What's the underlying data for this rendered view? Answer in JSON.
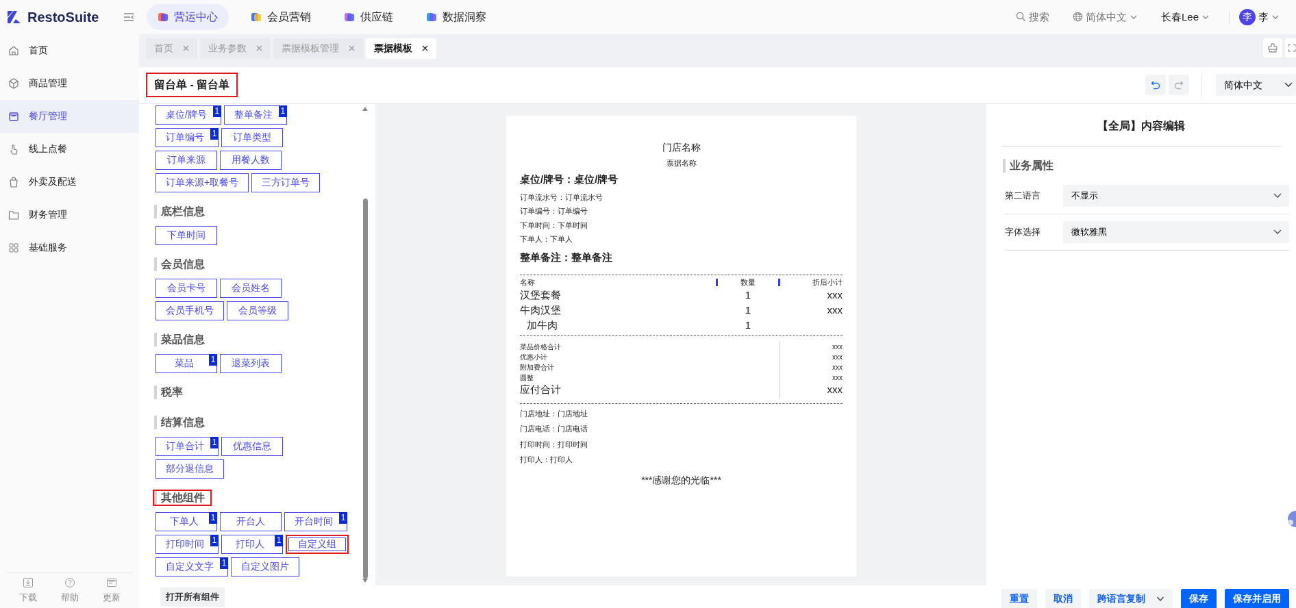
{
  "app": {
    "logo": "RestoSuite"
  },
  "top_nav": [
    {
      "label": "营运中心",
      "selected": true
    },
    {
      "label": "会员营销",
      "selected": false
    },
    {
      "label": "供应链",
      "selected": false
    },
    {
      "label": "数据洞察",
      "selected": false
    }
  ],
  "top_right": {
    "search": "搜索",
    "language": "简体中文",
    "store": "长春Lee",
    "avatar": "李",
    "user": "李"
  },
  "sidebar": {
    "items": [
      {
        "label": "首页",
        "selected": false
      },
      {
        "label": "商品管理",
        "selected": false
      },
      {
        "label": "餐厅管理",
        "selected": true
      },
      {
        "label": "线上点餐",
        "selected": false
      },
      {
        "label": "外卖及配送",
        "selected": false
      },
      {
        "label": "财务管理",
        "selected": false
      },
      {
        "label": "基础服务",
        "selected": false
      }
    ],
    "footer": [
      "下载",
      "帮助",
      "更新"
    ]
  },
  "tabs": [
    {
      "label": "首页",
      "selected": false
    },
    {
      "label": "业务参数",
      "selected": false
    },
    {
      "label": "票据模板管理",
      "selected": false
    },
    {
      "label": "票据模板",
      "selected": true
    }
  ],
  "header": {
    "title": "留台单 - 留台单",
    "highlighted": true,
    "language": "简体中文"
  },
  "components": {
    "sections": [
      {
        "rows": [
          [
            {
              "label": "桌位/牌号",
              "count": "1",
              "highlighted": false
            },
            {
              "label": "整单备注",
              "count": "1",
              "highlighted": false
            }
          ],
          [
            {
              "label": "订单编号",
              "count": "1",
              "highlighted": false
            },
            {
              "label": "订单类型",
              "highlighted": false
            }
          ],
          [
            {
              "label": "订单来源",
              "highlighted": false
            },
            {
              "label": "用餐人数",
              "highlighted": false
            }
          ],
          [
            {
              "label": "订单来源+取餐号",
              "highlighted": false
            },
            {
              "label": "三方订单号",
              "highlighted": false
            }
          ]
        ]
      },
      {
        "title": "底栏信息",
        "highlighted": false,
        "rows": [
          [
            {
              "label": "下单时间",
              "highlighted": false
            }
          ]
        ]
      },
      {
        "title": "会员信息",
        "highlighted": false,
        "rows": [
          [
            {
              "label": "会员卡号",
              "highlighted": false
            },
            {
              "label": "会员姓名",
              "highlighted": false
            }
          ],
          [
            {
              "label": "会员手机号",
              "highlighted": false
            },
            {
              "label": "会员等级",
              "highlighted": false
            }
          ]
        ]
      },
      {
        "title": "菜品信息",
        "highlighted": false,
        "rows": [
          [
            {
              "label": "菜品",
              "count": "1",
              "highlighted": false
            },
            {
              "label": "退菜列表",
              "highlighted": false
            }
          ]
        ]
      },
      {
        "title": "税率",
        "highlighted": false
      },
      {
        "title": "结算信息",
        "highlighted": false,
        "rows": [
          [
            {
              "label": "订单合计",
              "count": "1",
              "highlighted": false
            },
            {
              "label": "优惠信息",
              "highlighted": false
            }
          ],
          [
            {
              "label": "部分退信息",
              "highlighted": false
            }
          ]
        ]
      },
      {
        "title": "其他组件",
        "highlighted": true,
        "rows": [
          [
            {
              "label": "下单人",
              "count": "1",
              "highlighted": false
            },
            {
              "label": "开台人",
              "highlighted": false
            },
            {
              "label": "开台时间",
              "count": "1",
              "highlighted": false
            }
          ],
          [
            {
              "label": "打印时间",
              "count": "1",
              "highlighted": false
            },
            {
              "label": "打印人",
              "count": "1",
              "highlighted": false
            },
            {
              "label": "自定义组",
              "highlighted": true
            }
          ],
          [
            {
              "label": "自定义文字",
              "count": "1",
              "highlighted": false
            },
            {
              "label": "自定义图片",
              "highlighted": false
            }
          ]
        ]
      }
    ],
    "open_all_button": "打开所有组件"
  },
  "receipt": {
    "store_name": "门店名称",
    "receipt_name": "票据名称",
    "header_lines": [
      {
        "text": "桌位/牌号：桌位/牌号",
        "kind": "emphasis"
      },
      {
        "text": "订单流水号：订单流水号",
        "kind": "normal"
      },
      {
        "text": "订单编号：订单编号",
        "kind": "normal"
      },
      {
        "text": "下单时间：下单时间",
        "kind": "normal"
      },
      {
        "text": "下单人：下单人",
        "kind": "normal"
      },
      {
        "text": "整单备注：整单备注",
        "kind": "emphasis"
      }
    ],
    "columns": [
      "名称",
      "数量",
      "折后小计"
    ],
    "items": [
      {
        "name": "汉堡套餐",
        "qty": "1",
        "subtotal": "xxx",
        "kind": "dish"
      },
      {
        "name": "牛肉汉堡",
        "qty": "1",
        "subtotal": "xxx",
        "kind": "dish"
      },
      {
        "name": "加牛肉",
        "qty": "1",
        "kind": "modifier"
      }
    ],
    "totals": [
      {
        "label": "菜品价格合计",
        "value": "xxx",
        "kind": "normal"
      },
      {
        "label": "优惠小计",
        "value": "xxx",
        "kind": "normal"
      },
      {
        "label": "附加费合计",
        "value": "xxx",
        "kind": "normal"
      },
      {
        "label": "圆整",
        "value": "xxx",
        "kind": "normal"
      },
      {
        "label": "应付合计",
        "value": "xxx",
        "kind": "emphasis"
      }
    ],
    "footer_lines": [
      "门店地址：门店地址",
      "门店电话：门店电话",
      "打印时间：打印时间",
      "打印人：打印人"
    ],
    "thanks": "***感谢您的光临***"
  },
  "properties": {
    "title": "【全局】内容编辑",
    "section": "业务属性",
    "fields": [
      {
        "label": "第二语言",
        "value": "不显示"
      },
      {
        "label": "字体选择",
        "value": "微软雅黑"
      }
    ]
  },
  "actions": [
    {
      "label": "重置",
      "kind": "secondary"
    },
    {
      "label": "取消",
      "kind": "secondary"
    },
    {
      "label": "跨语言复制",
      "kind": "dropdown"
    },
    {
      "label": "保存",
      "kind": "primary"
    },
    {
      "label": "保存并启用",
      "kind": "primary"
    }
  ]
}
